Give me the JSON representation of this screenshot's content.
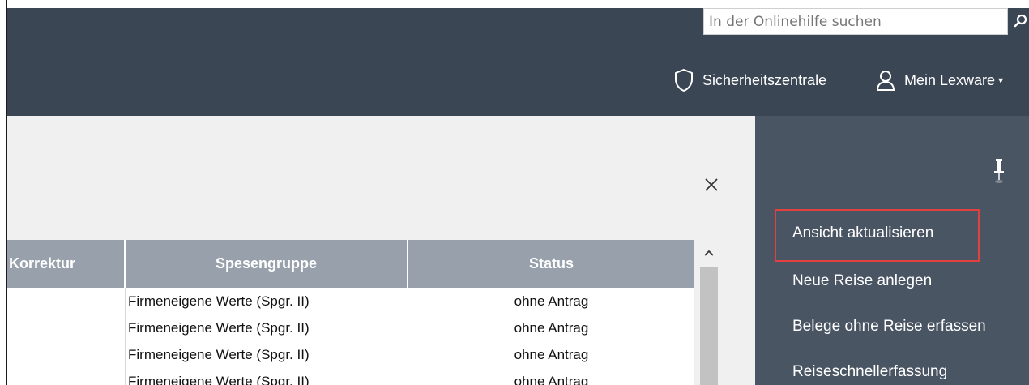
{
  "topbar": {
    "search_placeholder": "In der Onlinehilfe suchen"
  },
  "nav": {
    "security_label": "Sicherheitszentrale",
    "account_label": "Mein Lexware"
  },
  "table": {
    "columns": [
      "Korrektur",
      "Spesengruppe",
      "Status"
    ],
    "rows": [
      {
        "korrektur": "",
        "spesengruppe": "Firmeneigene Werte (Spgr. II)",
        "status": "ohne Antrag"
      },
      {
        "korrektur": "",
        "spesengruppe": "Firmeneigene Werte (Spgr. II)",
        "status": "ohne Antrag"
      },
      {
        "korrektur": "",
        "spesengruppe": "Firmeneigene Werte (Spgr. II)",
        "status": "ohne Antrag"
      },
      {
        "korrektur": "",
        "spesengruppe": "Firmeneigene Werte (Spgr. II)",
        "status": "ohne Antrag"
      }
    ]
  },
  "taskpane": {
    "items": [
      {
        "label": "Ansicht aktualisieren"
      },
      {
        "label": "Neue Reise anlegen"
      },
      {
        "label": "Belege ohne Reise erfassen"
      },
      {
        "label": "Reiseschnellerfassung"
      }
    ]
  },
  "icons": {
    "search": "search-icon",
    "security": "shield-icon",
    "account": "user-icon",
    "close": "close-icon",
    "pin": "pin-icon",
    "scroll_up": "chevron-up-icon"
  },
  "colors": {
    "header_bg": "#3b4655",
    "taskpane_bg": "#4a5564",
    "table_header_bg": "#97a0ab",
    "highlight": "#e0413f"
  }
}
